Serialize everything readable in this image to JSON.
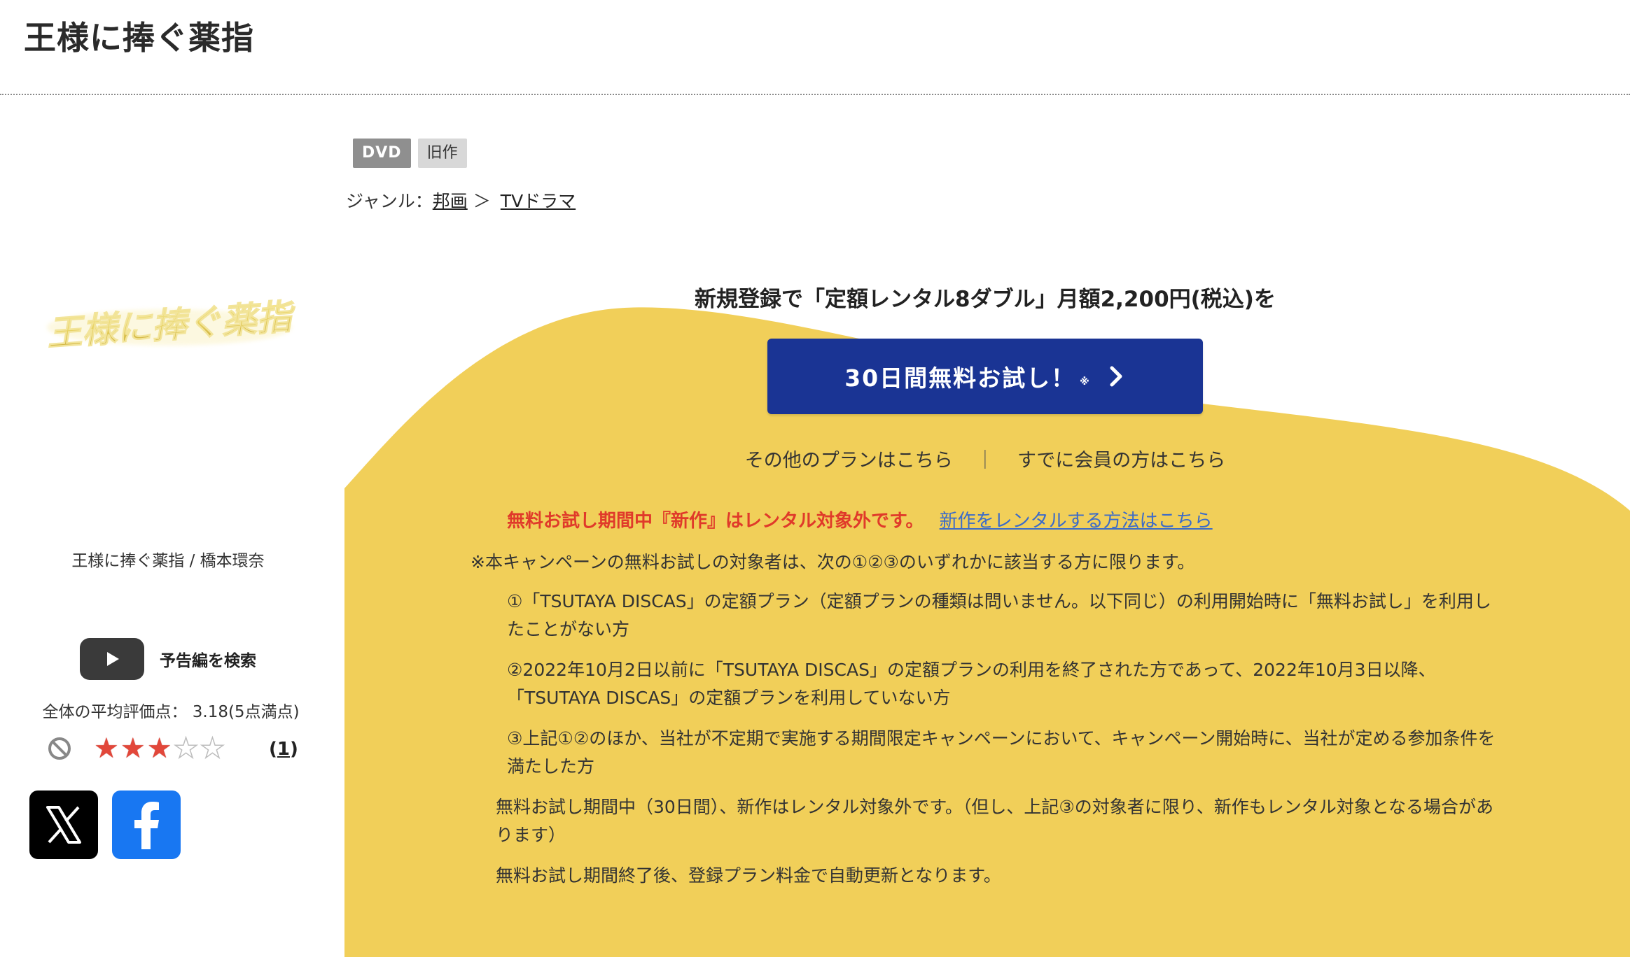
{
  "header": {
    "title": "王様に捧ぐ薬指"
  },
  "badges": {
    "format": "DVD",
    "release": "旧作"
  },
  "genre": {
    "label": "ジャンル：",
    "level1": "邦画",
    "arrow": "＞",
    "level2": "TVドラマ"
  },
  "left": {
    "cover_logo_text": "王様に捧ぐ薬指",
    "caption": "王様に捧ぐ薬指 / 橋本環奈",
    "trailer_label": "予告編を検索",
    "rating_text": "全体の平均評価点： 3.18(5点満点)",
    "rating_value": 3.18,
    "rating_max": 5,
    "stars_filled": 3,
    "review_count_open": "(",
    "review_count": "1",
    "review_count_close": ")"
  },
  "social": {
    "x_icon": "x-logo-icon",
    "facebook_icon": "facebook-logo-icon"
  },
  "campaign": {
    "headline": "新規登録で「定額レンタル8ダブル」月額2,200円(税込)を",
    "cta_label": "30日間無料お試し！",
    "cta_note": "※",
    "cta_chevron": "›",
    "other_plans": "その他のプランはこちら",
    "divider": "｜",
    "member_link": "すでに会員の方はこちら",
    "notice_red": "無料お試し期間中『新作』はレンタル対象外です。",
    "notice_link": "新作をレンタルする方法はこちら",
    "terms_lead": "※本キャンペーンの無料お試しの対象者は、次の①②③のいずれかに該当する方に限ります。",
    "terms": [
      "①「TSUTAYA DISCAS」の定額プラン（定額プランの種類は問いません。以下同じ）の利用開始時に「無料お試し」を利用したことがない方",
      "②2022年10月2日以前に「TSUTAYA DISCAS」の定額プランの利用を終了された方であって、2022年10月3日以降、「TSUTAYA DISCAS」の定額プランを利用していない方",
      "③上記①②のほか、当社が不定期で実施する期間限定キャンペーンにおいて、キャンペーン開始時に、当社が定める参加条件を満たした方"
    ],
    "note_1": "無料お試し期間中（30日間）、新作はレンタル対象外です。（但し、上記③の対象者に限り、新作もレンタル対象となる場合があります）",
    "note_2": "無料お試し期間終了後、登録プラン料金で自動更新となります。"
  },
  "colors": {
    "panel_yellow": "#f1cf59",
    "cta_blue": "#1a3494",
    "notice_red": "#e03a2a",
    "link_blue": "#3b6bc9"
  }
}
